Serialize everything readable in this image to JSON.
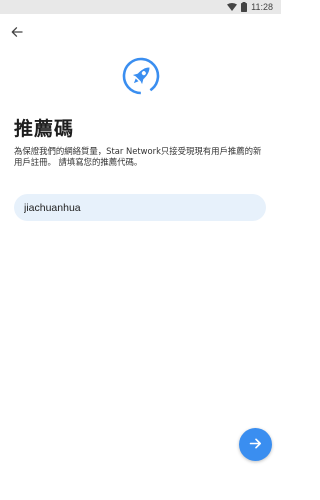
{
  "status_bar": {
    "time": "11:28",
    "icons": [
      "wifi-icon",
      "battery-icon"
    ]
  },
  "header": {
    "back_icon": "arrow-left-icon"
  },
  "logo": {
    "icon": "rocket-icon",
    "color": "#3a8ef0"
  },
  "page": {
    "title": "推薦碼",
    "description": "為保證我們的網絡質量，Star Network只接受現現有用戶推薦的新用戶註冊。 請填寫您的推薦代碼。"
  },
  "referral_input": {
    "value": "jiachuanhua"
  },
  "next_button": {
    "icon": "arrow-right-icon",
    "color": "#3a8ef0"
  },
  "colors": {
    "accent": "#3a8ef0",
    "input_bg": "#e7f1fb",
    "status_bar_bg": "#e8e8e8"
  }
}
